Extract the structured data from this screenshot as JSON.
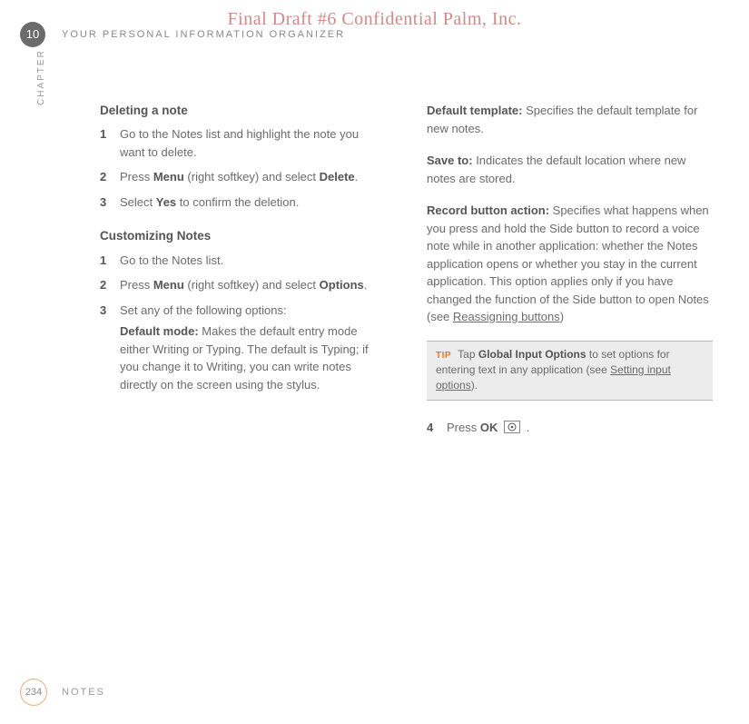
{
  "watermark": "Final Draft #6    Confidential    Palm, Inc.",
  "chapter_number": "10",
  "chapter_label": "CHAPTER",
  "running_head": "YOUR PERSONAL INFORMATION ORGANIZER",
  "page_number": "234",
  "footer_section": "NOTES",
  "left": {
    "heading1": "Deleting a note",
    "steps1": {
      "s1": "Go to the Notes list and highlight the note you want to delete.",
      "s2_pre": "Press ",
      "s2_b1": "Menu",
      "s2_mid": " (right softkey) and select ",
      "s2_b2": "Delete",
      "s2_post": ".",
      "s3_pre": "Select ",
      "s3_b1": "Yes",
      "s3_post": " to confirm the deletion."
    },
    "heading2": "Customizing Notes",
    "steps2": {
      "s1": "Go to the Notes list.",
      "s2_pre": "Press ",
      "s2_b1": "Menu",
      "s2_mid": " (right softkey) and select ",
      "s2_b2": "Options",
      "s2_post": ".",
      "s3": "Set any of the following options:",
      "s3_def_label": "Default mode:",
      "s3_def_body": " Makes the default entry mode either Writing or Typing. The default is Typing; if you change it to Writing, you can write notes directly on the screen using the stylus."
    }
  },
  "right": {
    "def1_label": "Default template:",
    "def1_body": " Specifies the default template for new notes.",
    "def2_label": "Save to:",
    "def2_body": " Indicates the default location where new notes are stored.",
    "def3_label": "Record button action:",
    "def3_body_1": " Specifies what happens when you press and hold the Side button to record a voice note while in another application: whether the Notes application opens or whether you stay in the current application. This option applies only if you have changed the function of the Side button to open Notes (see ",
    "def3_link": "Reassigning buttons",
    "def3_body_2": ")",
    "tip_marker": "TIP",
    "tip_pre": " Tap ",
    "tip_b": "Global Input Options",
    "tip_mid": " to set options for entering text in any application (see ",
    "tip_link": "Setting input options",
    "tip_post": ").",
    "step4_pre": "Press ",
    "step4_b": "OK",
    "step4_post": " ."
  },
  "numbers": {
    "n1": "1",
    "n2": "2",
    "n3": "3",
    "n4": "4"
  }
}
